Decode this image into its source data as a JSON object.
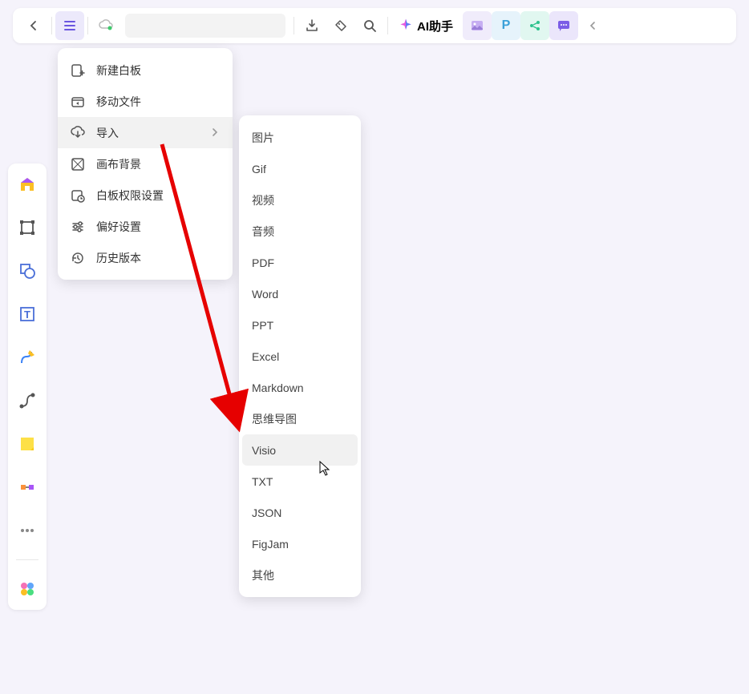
{
  "toolbar": {
    "ai_label": "AI助手"
  },
  "main_menu": {
    "items": [
      {
        "label": "新建白板"
      },
      {
        "label": "移动文件"
      },
      {
        "label": "导入"
      },
      {
        "label": "画布背景"
      },
      {
        "label": "白板权限设置"
      },
      {
        "label": "偏好设置"
      },
      {
        "label": "历史版本"
      }
    ]
  },
  "submenu": {
    "items": [
      {
        "label": "图片"
      },
      {
        "label": "Gif"
      },
      {
        "label": "视频"
      },
      {
        "label": "音频"
      },
      {
        "label": "PDF"
      },
      {
        "label": "Word"
      },
      {
        "label": "PPT"
      },
      {
        "label": "Excel"
      },
      {
        "label": "Markdown"
      },
      {
        "label": "思维导图"
      },
      {
        "label": "Visio"
      },
      {
        "label": "TXT"
      },
      {
        "label": "JSON"
      },
      {
        "label": "FigJam"
      },
      {
        "label": "其他"
      }
    ]
  }
}
